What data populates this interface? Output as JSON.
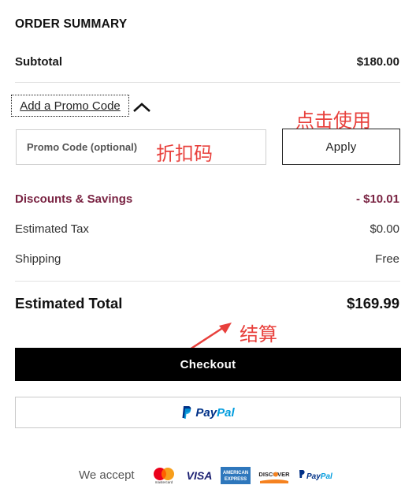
{
  "summary": {
    "title": "ORDER SUMMARY",
    "subtotal_label": "Subtotal",
    "subtotal_value": "$180.00",
    "promo_toggle_label": "Add a Promo Code",
    "promo_placeholder": "Promo Code (optional)",
    "apply_label": "Apply",
    "discount_label": "Discounts & Savings",
    "discount_value": "- $10.01",
    "tax_label": "Estimated Tax",
    "tax_value": "$0.00",
    "shipping_label": "Shipping",
    "shipping_value": "Free",
    "total_label": "Estimated Total",
    "total_value": "$169.99"
  },
  "actions": {
    "checkout_label": "Checkout",
    "paypal_pay": "Pay",
    "paypal_pal": "Pal"
  },
  "annotations": {
    "apply_note": "点击使用",
    "promo_note": "折扣码",
    "checkout_note": "结算"
  },
  "payment": {
    "accept_label": "We accept",
    "cards": [
      "mastercard",
      "VISA",
      "AMERICAN EXPRESS",
      "DISCOVER",
      "PayPal"
    ],
    "mastercard_caption": "mastercard",
    "amex_line1": "AMERICAN",
    "amex_line2": "EXPRESS",
    "discover_label": "DISCOVER",
    "visa_label": "VISA",
    "paypal_pay": "Pay",
    "paypal_pal": "Pal"
  },
  "colors": {
    "discount": "#7a2443",
    "annotation": "#e8403c",
    "checkout_bg": "#000000",
    "paypal_dark": "#003087",
    "paypal_light": "#009cde"
  }
}
